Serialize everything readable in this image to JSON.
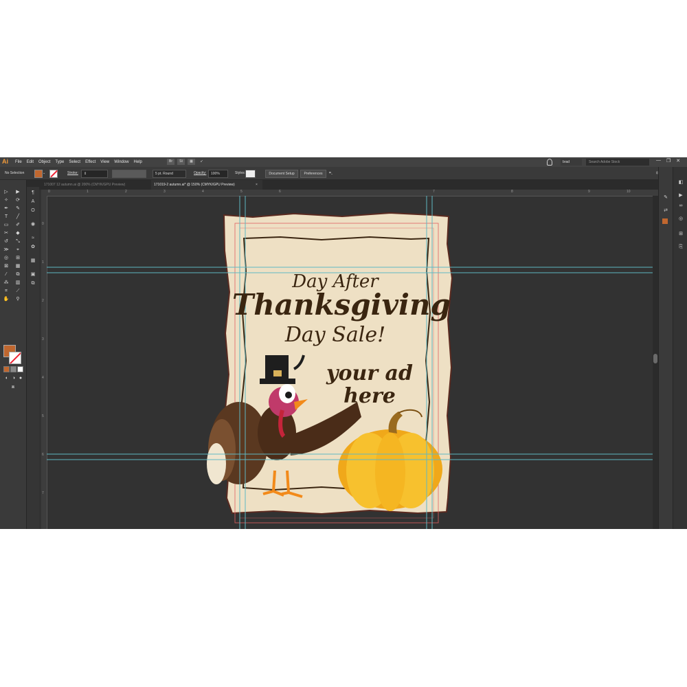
{
  "app": {
    "logo": "Ai",
    "menu": [
      "File",
      "Edit",
      "Object",
      "Type",
      "Select",
      "Effect",
      "View",
      "Window",
      "Help"
    ],
    "bridge_icons": [
      "Br",
      "St"
    ],
    "user": "brad",
    "search_placeholder": "Search Adobe Stock"
  },
  "control": {
    "selection": "No Selection",
    "stroke_label": "Stroke:",
    "brush": "5 pt. Round",
    "opacity_label": "Opacity:",
    "opacity_value": "100%",
    "styles_label": "Styles:",
    "document_setup": "Document Setup",
    "preferences": "Preferences",
    "fill_color": "#c0672f"
  },
  "tabs": [
    {
      "label": "171007 12 autumn.ai @ 200% (CMYK/GPU Preview)",
      "active": false
    },
    {
      "label": "171019-2 autumn.ai* @ 150% (CMYK/GPU Preview)",
      "active": true,
      "close": "×"
    }
  ],
  "ruler": {
    "h_ticks": [
      "0",
      "1",
      "2",
      "3",
      "4",
      "5",
      "6",
      "7",
      "8",
      "9",
      "10"
    ],
    "v_ticks": [
      "0",
      "1",
      "2",
      "3",
      "4",
      "5",
      "6",
      "7"
    ]
  },
  "artwork": {
    "line1": "Day After",
    "line2": "Thanksgiving",
    "line3": "Day Sale!",
    "line4": "your ad",
    "line5": "here",
    "paper_color": "#f0e2c8",
    "text_color": "#3a2510"
  }
}
